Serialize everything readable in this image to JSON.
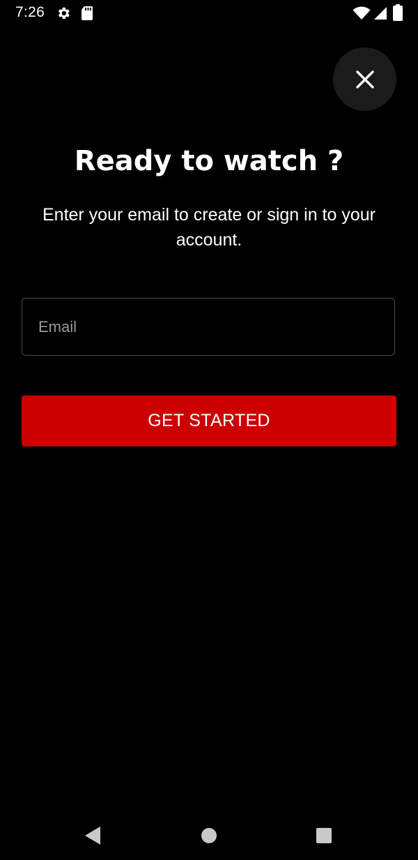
{
  "status_bar": {
    "time": "7:26",
    "icons": [
      "gear-icon",
      "sd-card-icon",
      "wifi-icon",
      "signal-icon",
      "battery-icon"
    ]
  },
  "close_button": {
    "icon": "close-icon"
  },
  "title": "Ready to watch ?",
  "subtitle": "Enter your email to create or sign in to your account.",
  "email": {
    "value": "",
    "placeholder": "Email"
  },
  "cta": {
    "label": "GET STARTED"
  },
  "nav_bar": {
    "icons": [
      "back-icon",
      "home-icon",
      "recents-icon"
    ]
  },
  "colors": {
    "background": "#000000",
    "accent": "#cc0000",
    "close_bg": "#1b1b1b",
    "text": "#ffffff",
    "placeholder": "#9a9a9a",
    "field_border": "#4a4a4a"
  }
}
